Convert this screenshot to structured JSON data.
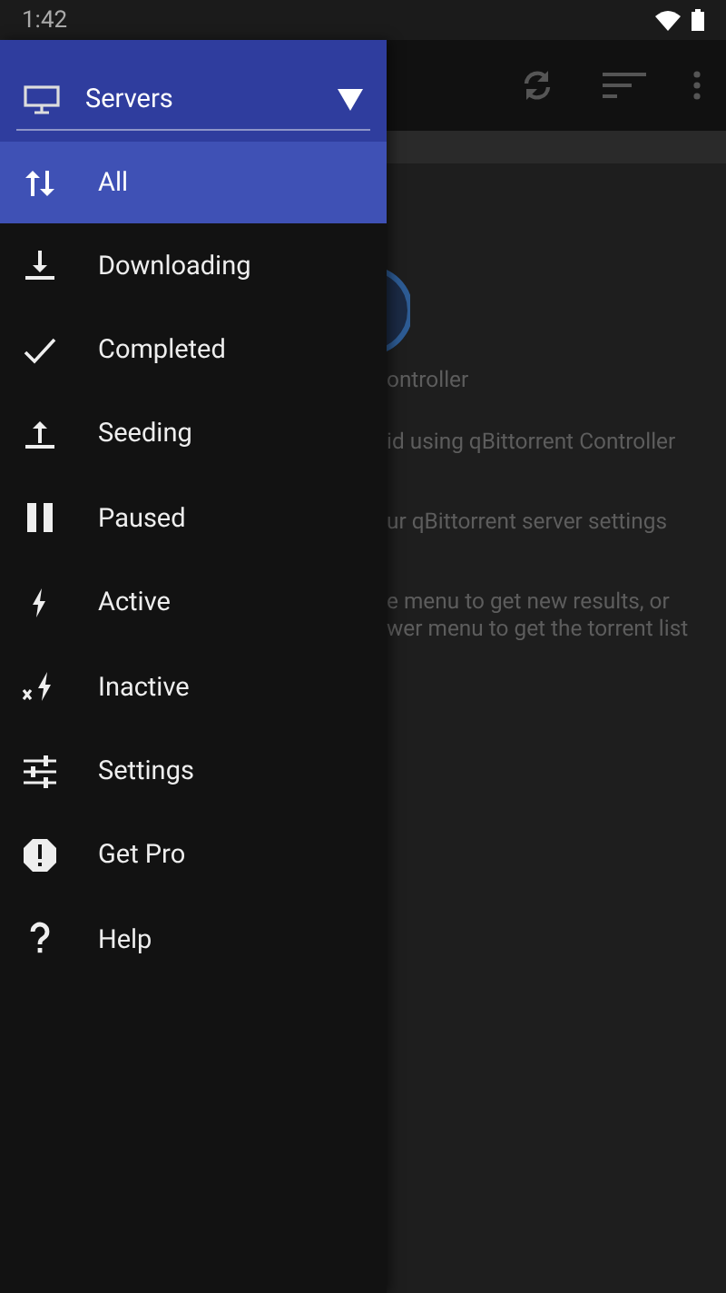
{
  "status_bar": {
    "time": "1:42"
  },
  "content": {
    "lines": [
      "ontroller",
      "id using qBittorrent Controller",
      "ur qBittorrent server settings",
      "e menu to get new results, or\nwer menu to get the torrent list"
    ]
  },
  "drawer": {
    "server_picker": {
      "label": "Servers"
    },
    "items": [
      {
        "label": "All",
        "selected": true
      },
      {
        "label": "Downloading",
        "selected": false
      },
      {
        "label": "Completed",
        "selected": false
      },
      {
        "label": "Seeding",
        "selected": false
      },
      {
        "label": "Paused",
        "selected": false
      },
      {
        "label": "Active",
        "selected": false
      },
      {
        "label": "Inactive",
        "selected": false
      },
      {
        "label": "Settings",
        "selected": false
      },
      {
        "label": "Get Pro",
        "selected": false
      },
      {
        "label": "Help",
        "selected": false
      }
    ]
  }
}
